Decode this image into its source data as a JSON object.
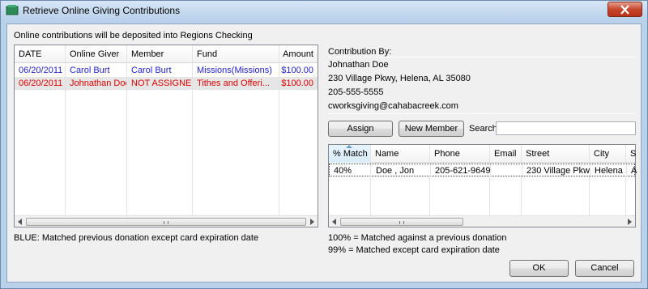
{
  "window": {
    "title": "Retrieve Online Giving Contributions"
  },
  "deposit_text": "Online contributions will be deposited into Regions Checking",
  "contributions": {
    "columns": [
      "DATE",
      "Online Giver",
      "Member",
      "Fund",
      "Amount"
    ],
    "rows": [
      {
        "date": "06/20/2011",
        "giver": "Carol Burt",
        "member": "Carol Burt",
        "fund": "Missions(Missions)",
        "amount": "$100.00",
        "color": "#1f1fd0"
      },
      {
        "date": "06/20/2011",
        "giver": "Johnathan Doe",
        "member": "NOT ASSIGNED",
        "fund": "Tithes and Offeri...",
        "amount": "$100.00",
        "color": "#e00000"
      }
    ]
  },
  "legend": "BLUE: Matched previous donation except card expiration date",
  "contributor": {
    "heading": "Contribution By:",
    "name": "Johnathan Doe",
    "address": "230 Village Pkwy, Helena, AL  35080",
    "phone": "205-555-5555",
    "email": "cworksgiving@cahabacreek.com"
  },
  "buttons": {
    "assign": "Assign",
    "new_member": "New Member",
    "ok": "OK",
    "cancel": "Cancel"
  },
  "search": {
    "label": "Search:",
    "value": ""
  },
  "matches": {
    "columns": [
      "% Match",
      "Name",
      "Phone",
      "Email",
      "Street",
      "City",
      "S"
    ],
    "rows": [
      {
        "match": "40%",
        "name": "Doe , Jon",
        "phone": "205-621-9649",
        "email": "",
        "street": "230 Village Pkwy",
        "city": "Helena",
        "state": "A"
      }
    ]
  },
  "notes": {
    "match_100": "100% = Matched against a previous donation",
    "match_99": "99% = Matched except card expiration date"
  },
  "colors": {
    "blue_row": "#1f1fd0",
    "red_row": "#e00000",
    "selected_row": "#e6e6e6"
  }
}
